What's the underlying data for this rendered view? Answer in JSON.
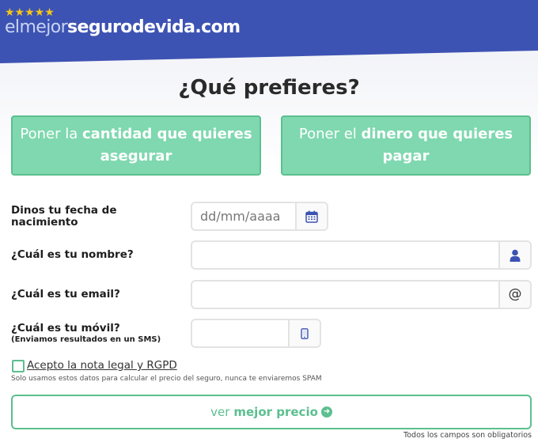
{
  "header": {
    "stars": "★★★★★",
    "brand_part1": "elmejor",
    "brand_part2": "segurodevida.com"
  },
  "title": "¿Qué prefieres?",
  "options": [
    {
      "light": "Poner la ",
      "strong": "cantidad que quieres asegurar"
    },
    {
      "light": "Poner el ",
      "strong": "dinero que quieres pagar"
    }
  ],
  "fields": {
    "birthdate": {
      "label": "Dinos tu fecha de nacimiento",
      "placeholder": "dd/mm/aaaa",
      "value": "",
      "icon": "calendar-icon"
    },
    "name": {
      "label": "¿Cuál es tu nombre?",
      "placeholder": "",
      "value": "",
      "icon": "user-icon"
    },
    "email": {
      "label": "¿Cuál es tu email?",
      "placeholder": "",
      "value": "",
      "icon": "at-icon"
    },
    "mobile": {
      "label": "¿Cuál es tu móvil?",
      "sublabel": "(Enviamos resultados en un SMS)",
      "placeholder": "",
      "value": "",
      "icon": "mobile-icon"
    }
  },
  "consent": {
    "label": "Acepto la nota legal y RGPD",
    "checked": false,
    "disclaimer": "Solo usamos estos datos para calcular el precio del seguro, nunca te enviaremos SPAM"
  },
  "submit": {
    "light": "ver",
    "strong": "mejor precio",
    "icon": "arrow-circle-right-icon"
  },
  "footnote": "Todos los campos son obligatorios",
  "colors": {
    "header_bg": "#3d53b3",
    "accent_green": "#5cbf8f",
    "option_bg": "#7fd8af",
    "icon_blue": "#3d53b3",
    "star_yellow": "#f5c518"
  }
}
